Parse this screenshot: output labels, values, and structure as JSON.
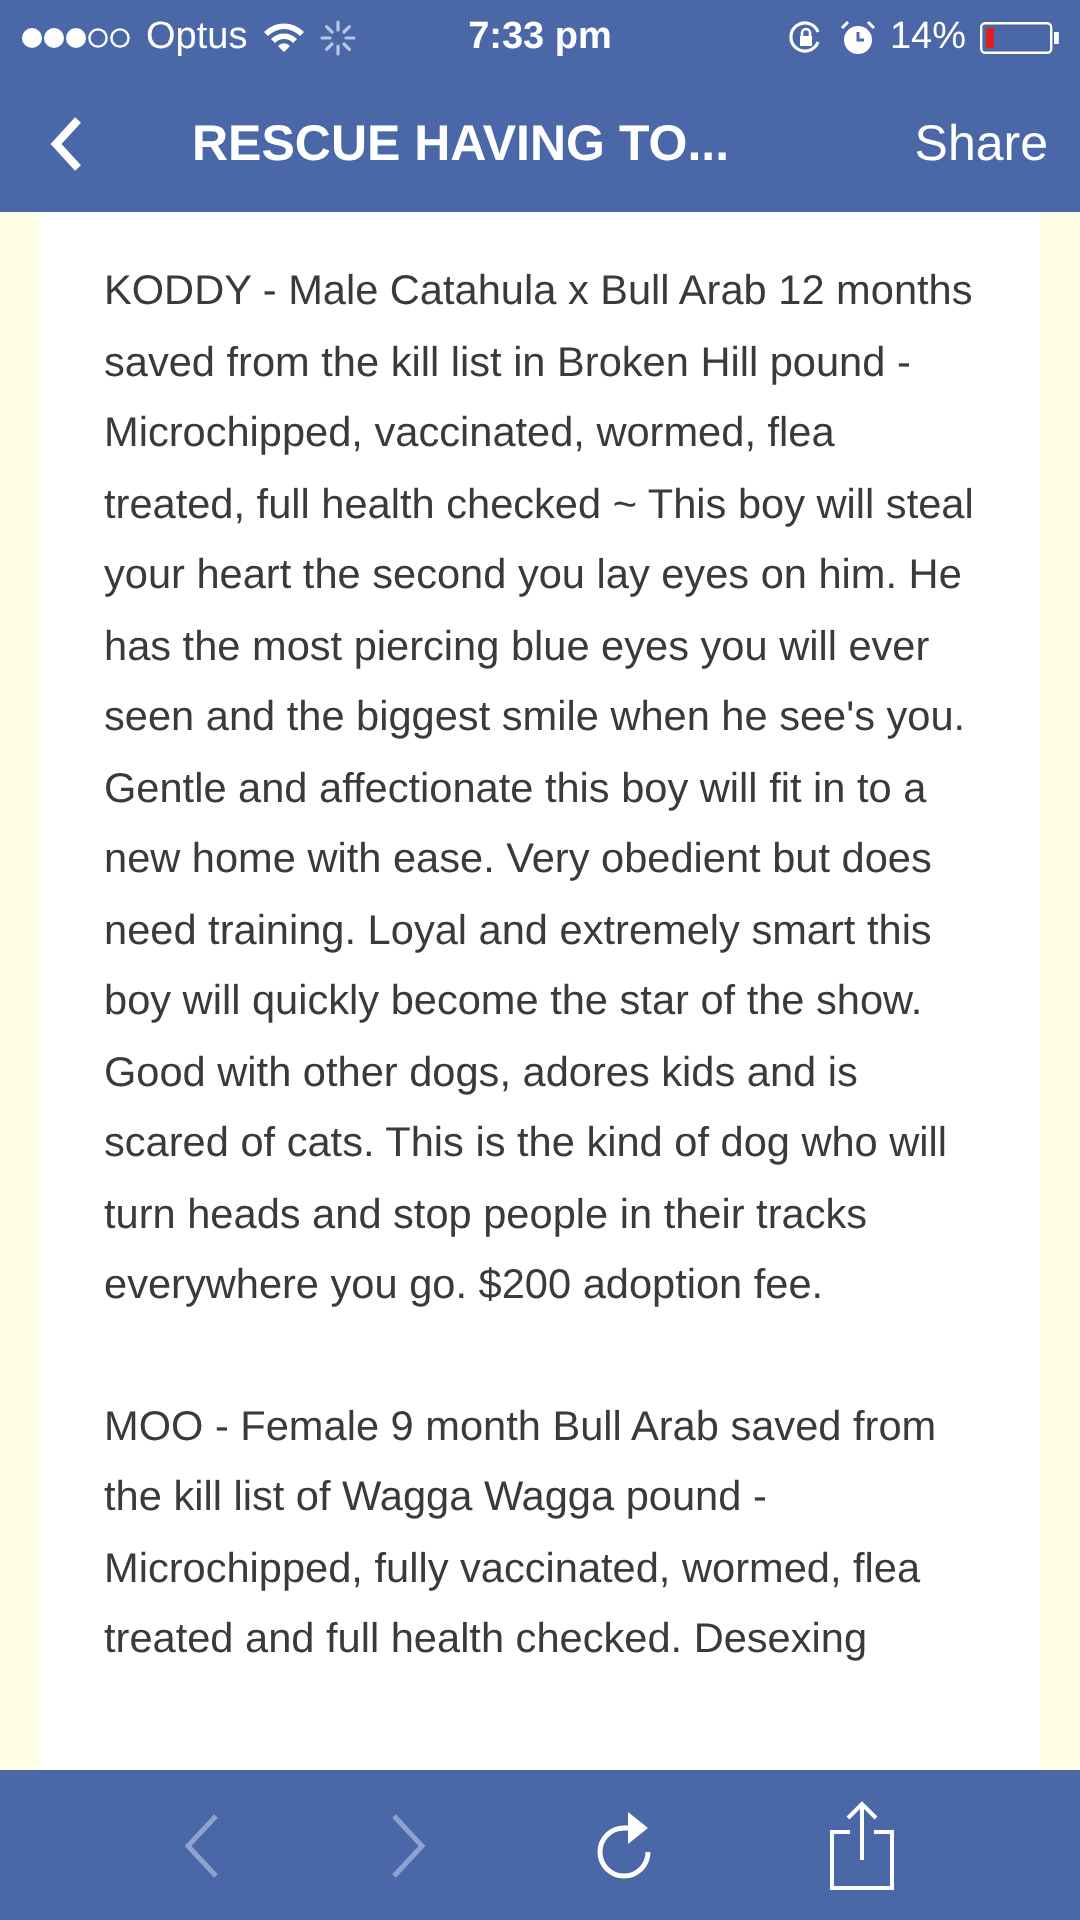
{
  "status_bar": {
    "carrier": "Optus",
    "time": "7:33 pm",
    "battery": "14%"
  },
  "nav_bar": {
    "title": "RESCUE HAVING TO...",
    "action": "Share"
  },
  "paragraphs": [
    "KODDY - Male Catahula x Bull Arab 12 months saved from the kill list in Broken Hill pound - Microchipped, vaccinated, wormed, flea treated, full health checked ~ This boy will steal your heart the second you lay eyes on him. He has the most piercing blue eyes you will ever seen and the biggest smile when he see's you. Gentle and affectionate this boy will fit in to a new home with ease. Very obedient but does need training. Loyal and extremely smart this boy will quickly become the star of the show. Good with other dogs, adores kids and is scared of cats. This is the kind of dog who will turn heads and stop people in their tracks everywhere you go. $200 adoption fee.",
    "MOO - Female 9 month Bull Arab saved from the kill list of Wagga Wagga pound - Microchipped, fully vaccinated, wormed, flea treated and full health checked. Desexing"
  ],
  "toolbar": [
    {
      "kind": "back",
      "disabled": true
    },
    {
      "kind": "forward",
      "disabled": true
    },
    {
      "kind": "reload",
      "disabled": false
    },
    {
      "kind": "share",
      "disabled": false
    }
  ]
}
